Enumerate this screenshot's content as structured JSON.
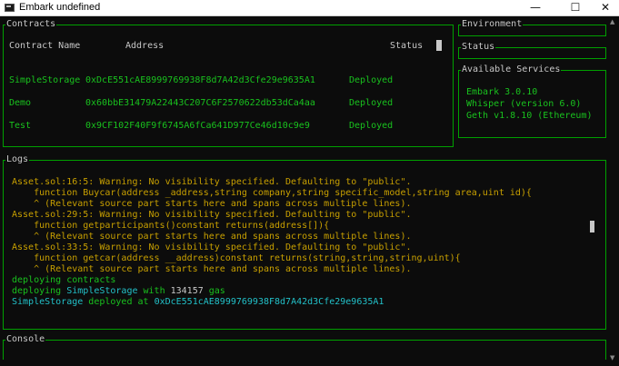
{
  "window": {
    "title": "Embark undefined",
    "minimize_icon": "minimize-icon",
    "maximize_icon": "maximize-icon",
    "close_icon": "close-icon"
  },
  "contracts": {
    "title": "Contracts",
    "headers": {
      "name": "Contract Name",
      "address": "Address",
      "status": "Status"
    },
    "rows": [
      {
        "name": "SimpleStorage",
        "address": "0xDcE551cAE8999769938F8d7A42d3Cfe29e9635A1",
        "status": "Deployed"
      },
      {
        "name": "Demo",
        "address": "0x60bbE31479A22443C207C6F2570622db53dCa4aa",
        "status": "Deployed"
      },
      {
        "name": "Test",
        "address": "0x9CF102F40F9f6745A6fCa641D977Ce46d10c9e9",
        "status": "Deployed"
      }
    ]
  },
  "environment": {
    "title": "Environment"
  },
  "status": {
    "title": "Status"
  },
  "services": {
    "title": "Available Services",
    "items": [
      "Embark 3.0.10",
      "Whisper (version 6.0)",
      "Geth v1.8.10 (Ethereum)"
    ]
  },
  "logs": {
    "title": "Logs",
    "lines": [
      "Asset.sol:16:5: Warning: No visibility specified. Defaulting to \"public\".",
      "    function Buycar(address _address,string company,string specific_model,string area,uint id){",
      "    ^ (Relevant source part starts here and spans across multiple lines).",
      "Asset.sol:29:5: Warning: No visibility specified. Defaulting to \"public\".",
      "    function getparticipants()constant returns(address[]){",
      "    ^ (Relevant source part starts here and spans across multiple lines).",
      "Asset.sol:33:5: Warning: No visibility specified. Defaulting to \"public\".",
      "    function getcar(address __address)constant returns(string,string,string,uint){",
      "    ^ (Relevant source part starts here and spans across multiple lines).",
      "deploying contracts"
    ],
    "deploy_line": {
      "a": "deploying ",
      "b": "SimpleStorage",
      "c": " with ",
      "d": "134157",
      "e": " gas"
    },
    "deployed_line": {
      "a": "SimpleStorage",
      "b": " deployed at ",
      "c": "0xDcE551cAE8999769938F8d7A42d3Cfe29e9635A1"
    }
  },
  "console": {
    "title": "Console"
  },
  "colors": {
    "border": "#00a000",
    "text_green": "#19c21e",
    "text_gold": "#c8a000",
    "text_cyan": "#22c0c8",
    "background": "#0c0c0c"
  }
}
